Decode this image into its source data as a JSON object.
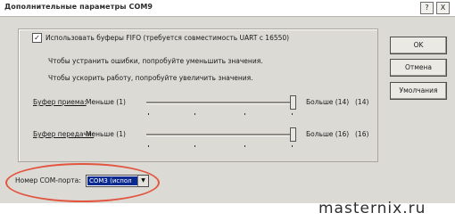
{
  "window": {
    "title": "Дополнительные параметры COM9",
    "help_label": "?",
    "close_label": "X"
  },
  "fifo": {
    "checkbox_mark": "✓",
    "label": "Использовать буферы FIFO (требуется совместимость UART с 16550)",
    "hint_errors": "Чтобы устранить ошибки, попробуйте уменьшить значения.",
    "hint_speed": "Чтобы ускорить работу, попробуйте увеличить значения."
  },
  "receive_buffer": {
    "label": "Буфер приема:",
    "min_label": "Меньше (1)",
    "max_label": "Больше (14)",
    "value_label": "(14)",
    "level": 1.0
  },
  "transmit_buffer": {
    "label": "Буфер передачи:",
    "min_label": "Меньше (1)",
    "max_label": "Больше (16)",
    "value_label": "(16)",
    "level": 1.0
  },
  "buttons": {
    "ok": "OK",
    "cancel": "Отмена",
    "defaults": "Умолчания"
  },
  "com_port": {
    "label": "Номер COM-порта:",
    "selected": "COM3 (испол"
  },
  "highlight_color": "#e2553f",
  "watermark": "masternix.ru"
}
